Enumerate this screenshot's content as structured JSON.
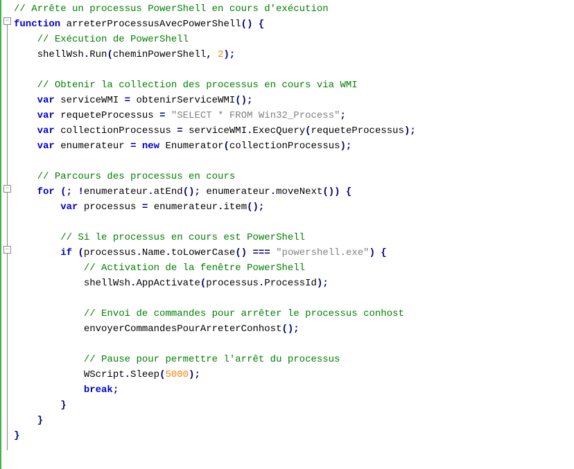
{
  "code": {
    "l1_comment": "// Arrête un processus PowerShell en cours d'exécution",
    "l2_kw_function": "function",
    "l2_funcname": "arreterProcessusAvecPowerShell",
    "l3_comment": "// Exécution de PowerShell",
    "l4_obj": "shellWsh",
    "l4_method": "Run",
    "l4_arg1": "cheminPowerShell",
    "l4_arg2": "2",
    "l5_comment": "// Obtenir la collection des processus en cours via WMI",
    "l6_kw_var": "var",
    "l6_name": "serviceWMI",
    "l6_rhs": "obtenirServiceWMI",
    "l7_kw_var": "var",
    "l7_name": "requeteProcessus",
    "l7_string": "\"SELECT * FROM Win32_Process\"",
    "l8_kw_var": "var",
    "l8_name": "collectionProcessus",
    "l8_obj": "serviceWMI",
    "l8_method": "ExecQuery",
    "l8_arg": "requeteProcessus",
    "l9_kw_var": "var",
    "l9_name": "enumerateur",
    "l9_kw_new": "new",
    "l9_ctor": "Enumerator",
    "l9_arg": "collectionProcessus",
    "l10_comment": "// Parcours des processus en cours",
    "l11_kw_for": "for",
    "l11_not": "!",
    "l11_obj1": "enumerateur",
    "l11_m1": "atEnd",
    "l11_obj2": "enumerateur",
    "l11_m2": "moveNext",
    "l12_kw_var": "var",
    "l12_name": "processus",
    "l12_obj": "enumerateur",
    "l12_method": "item",
    "l13_comment": "// Si le processus en cours est PowerShell",
    "l14_kw_if": "if",
    "l14_obj": "processus",
    "l14_prop": "Name",
    "l14_method": "toLowerCase",
    "l14_op": "===",
    "l14_string": "\"powershell.exe\"",
    "l15_comment": "// Activation de la fenêtre PowerShell",
    "l16_obj": "shellWsh",
    "l16_method": "AppActivate",
    "l16_argobj": "processus",
    "l16_argprop": "ProcessId",
    "l17_comment": "// Envoi de commandes pour arrêter le processus conhost",
    "l18_func": "envoyerCommandesPourArreterConhost",
    "l19_comment": "// Pause pour permettre l'arrêt du processus",
    "l20_obj": "WScript",
    "l20_method": "Sleep",
    "l20_arg": "5000",
    "l21_kw_break": "break",
    "fold_glyph": "−"
  }
}
